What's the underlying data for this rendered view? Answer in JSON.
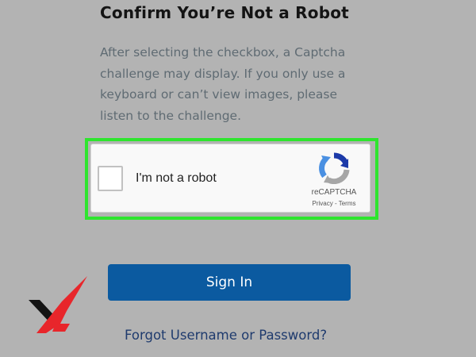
{
  "page": {
    "title": "Confirm You’re Not a Robot",
    "description_lines": [
      "After selecting the checkbox, a Captcha",
      "challenge may display. If you only use a",
      "keyboard or can’t view images, please",
      "listen to the challenge."
    ]
  },
  "captcha": {
    "label": "I'm not a robot",
    "checked": false,
    "brand": "reCAPTCHA",
    "privacy_link": "Privacy",
    "separator": " - ",
    "terms_link": "Terms",
    "highlight_color": "#2ee52e",
    "icon": "recaptcha-logo-icon"
  },
  "actions": {
    "signin_label": "Sign In",
    "forgot_link": "Forgot Username or Password?"
  },
  "colors": {
    "background": "#b3b3b3",
    "button": "#0b5aa0",
    "link": "#1f3b6e",
    "watermark_red": "#e8262b"
  },
  "watermark": {
    "icon": "brand-x-logo"
  }
}
